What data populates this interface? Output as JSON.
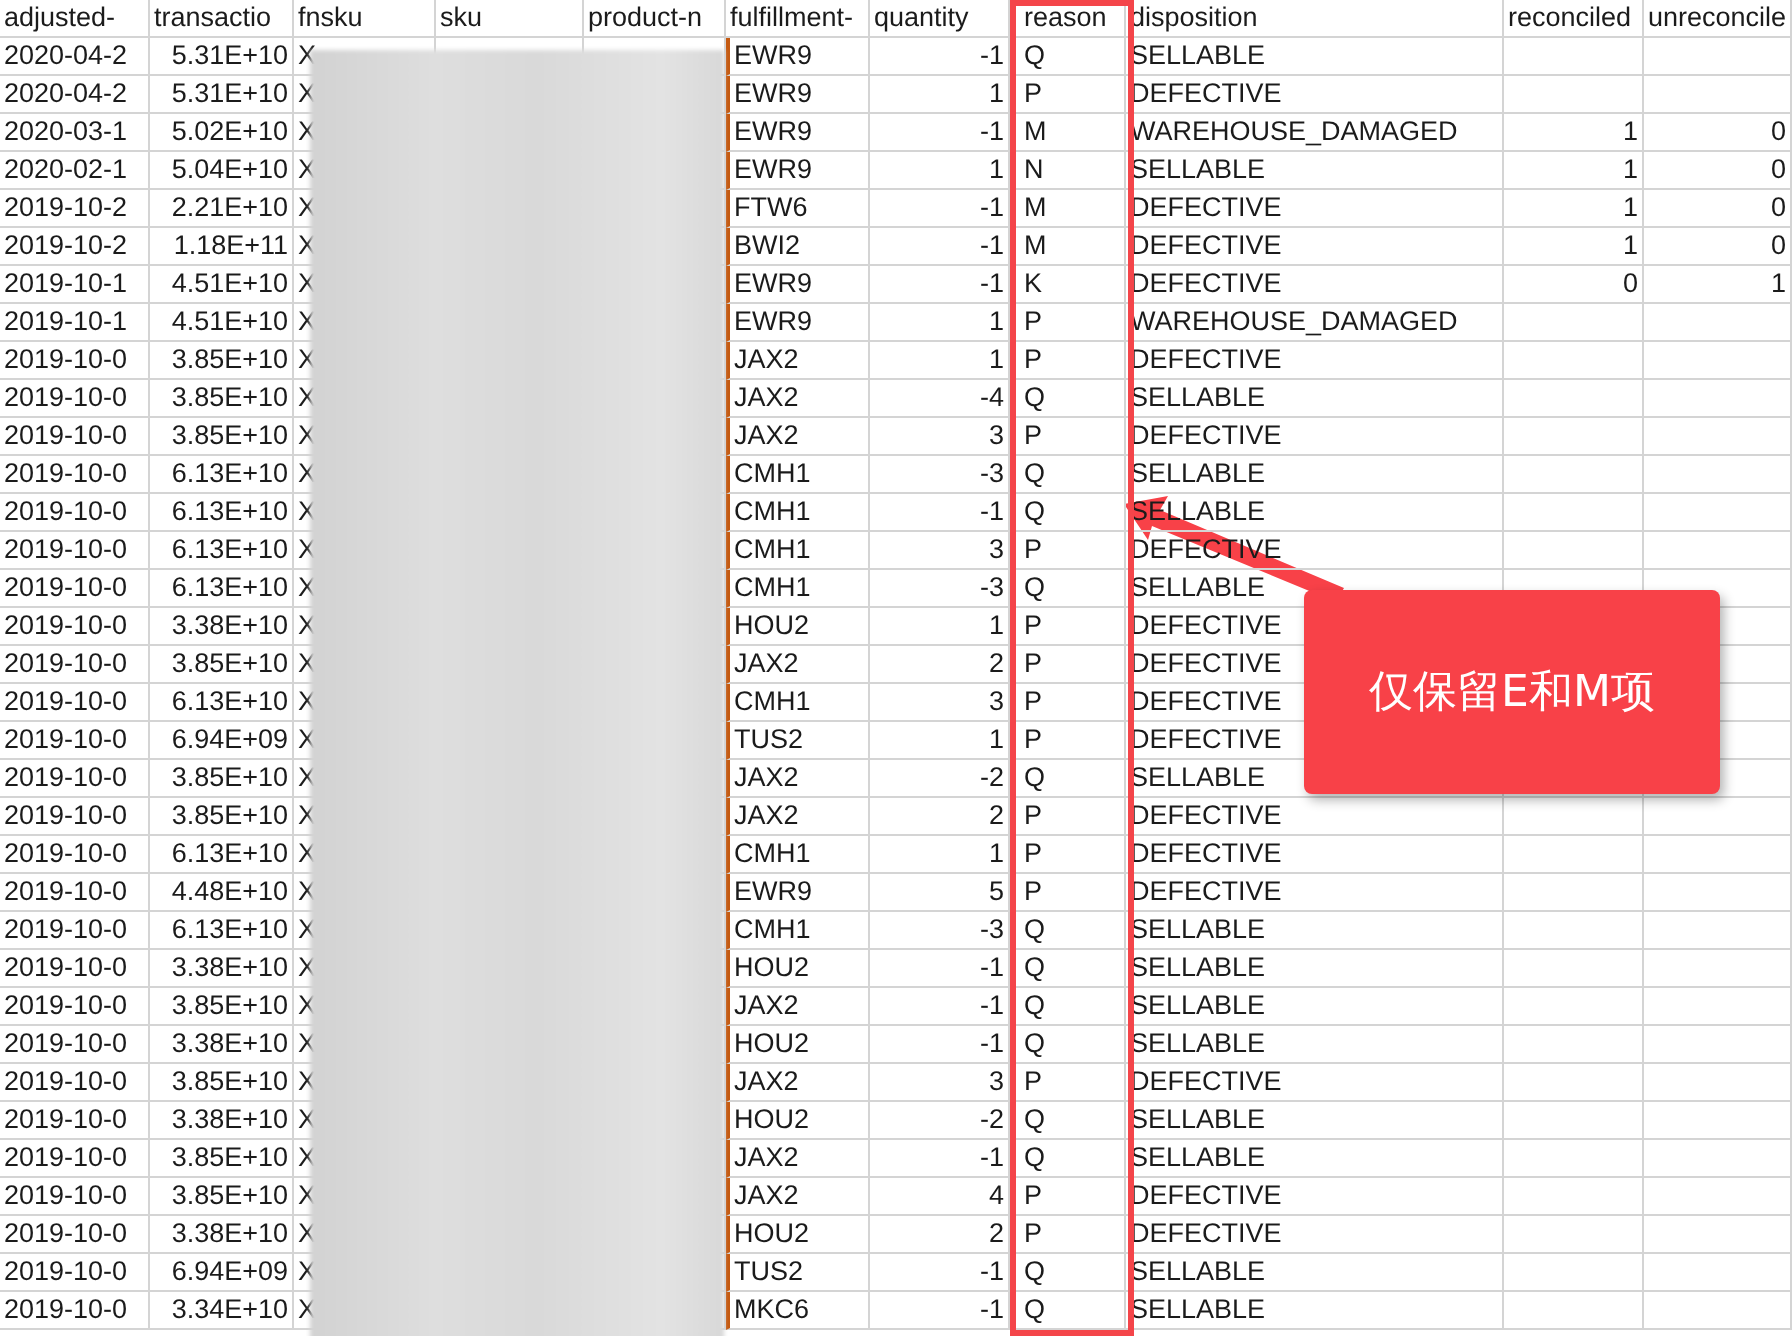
{
  "columns": [
    "adjusted-",
    "transactio",
    "fnsku",
    "sku",
    "product-n",
    "fulfillment-",
    "quantity",
    "reason",
    "disposition",
    "reconciled",
    "unreconcile"
  ],
  "rows": [
    {
      "date": "2020-04-2",
      "transaction": "5.31E+10",
      "fnsku": "X",
      "fc": "EWR9",
      "quantity": "-1",
      "reason": "Q",
      "disposition": "SELLABLE"
    },
    {
      "date": "2020-04-2",
      "transaction": "5.31E+10",
      "fnsku": "X",
      "fc": "EWR9",
      "quantity": "1",
      "reason": "P",
      "disposition": "DEFECTIVE"
    },
    {
      "date": "2020-03-1",
      "transaction": "5.02E+10",
      "fnsku": "X",
      "fc": "EWR9",
      "quantity": "-1",
      "reason": "M",
      "disposition": "WAREHOUSE_DAMAGED",
      "reconciled": "1",
      "unreconciled": "0"
    },
    {
      "date": "2020-02-1",
      "transaction": "5.04E+10",
      "fnsku": "X",
      "fc": "EWR9",
      "quantity": "1",
      "reason": "N",
      "disposition": "SELLABLE",
      "reconciled": "1",
      "unreconciled": "0"
    },
    {
      "date": "2019-10-2",
      "transaction": "2.21E+10",
      "fnsku": "X",
      "fc": "FTW6",
      "quantity": "-1",
      "reason": "M",
      "disposition": "DEFECTIVE",
      "reconciled": "1",
      "unreconciled": "0"
    },
    {
      "date": "2019-10-2",
      "transaction": "1.18E+11",
      "fnsku": "X",
      "fc": "BWI2",
      "quantity": "-1",
      "reason": "M",
      "disposition": "DEFECTIVE",
      "reconciled": "1",
      "unreconciled": "0"
    },
    {
      "date": "2019-10-1",
      "transaction": "4.51E+10",
      "fnsku": "X",
      "fc": "EWR9",
      "quantity": "-1",
      "reason": "K",
      "disposition": "DEFECTIVE",
      "reconciled": "0",
      "unreconciled": "1"
    },
    {
      "date": "2019-10-1",
      "transaction": "4.51E+10",
      "fnsku": "X",
      "fc": "EWR9",
      "quantity": "1",
      "reason": "P",
      "disposition": "WAREHOUSE_DAMAGED"
    },
    {
      "date": "2019-10-0",
      "transaction": "3.85E+10",
      "fnsku": "X",
      "fc": "JAX2",
      "quantity": "1",
      "reason": "P",
      "disposition": "DEFECTIVE"
    },
    {
      "date": "2019-10-0",
      "transaction": "3.85E+10",
      "fnsku": "X",
      "fc": "JAX2",
      "quantity": "-4",
      "reason": "Q",
      "disposition": "SELLABLE"
    },
    {
      "date": "2019-10-0",
      "transaction": "3.85E+10",
      "fnsku": "X",
      "fc": "JAX2",
      "quantity": "3",
      "reason": "P",
      "disposition": "DEFECTIVE"
    },
    {
      "date": "2019-10-0",
      "transaction": "6.13E+10",
      "fnsku": "X",
      "fc": "CMH1",
      "quantity": "-3",
      "reason": "Q",
      "disposition": "SELLABLE"
    },
    {
      "date": "2019-10-0",
      "transaction": "6.13E+10",
      "fnsku": "X",
      "fc": "CMH1",
      "quantity": "-1",
      "reason": "Q",
      "disposition": "SELLABLE"
    },
    {
      "date": "2019-10-0",
      "transaction": "6.13E+10",
      "fnsku": "X",
      "fc": "CMH1",
      "quantity": "3",
      "reason": "P",
      "disposition": "DEFECTIVE"
    },
    {
      "date": "2019-10-0",
      "transaction": "6.13E+10",
      "fnsku": "X",
      "fc": "CMH1",
      "quantity": "-3",
      "reason": "Q",
      "disposition": "SELLABLE"
    },
    {
      "date": "2019-10-0",
      "transaction": "3.38E+10",
      "fnsku": "X",
      "fc": "HOU2",
      "quantity": "1",
      "reason": "P",
      "disposition": "DEFECTIVE"
    },
    {
      "date": "2019-10-0",
      "transaction": "3.85E+10",
      "fnsku": "X",
      "fc": "JAX2",
      "quantity": "2",
      "reason": "P",
      "disposition": "DEFECTIVE"
    },
    {
      "date": "2019-10-0",
      "transaction": "6.13E+10",
      "fnsku": "X",
      "fc": "CMH1",
      "quantity": "3",
      "reason": "P",
      "disposition": "DEFECTIVE"
    },
    {
      "date": "2019-10-0",
      "transaction": "6.94E+09",
      "fnsku": "X",
      "fc": "TUS2",
      "quantity": "1",
      "reason": "P",
      "disposition": "DEFECTIVE"
    },
    {
      "date": "2019-10-0",
      "transaction": "3.85E+10",
      "fnsku": "X",
      "fc": "JAX2",
      "quantity": "-2",
      "reason": "Q",
      "disposition": "SELLABLE"
    },
    {
      "date": "2019-10-0",
      "transaction": "3.85E+10",
      "fnsku": "X",
      "fc": "JAX2",
      "quantity": "2",
      "reason": "P",
      "disposition": "DEFECTIVE"
    },
    {
      "date": "2019-10-0",
      "transaction": "6.13E+10",
      "fnsku": "X",
      "fc": "CMH1",
      "quantity": "1",
      "reason": "P",
      "disposition": "DEFECTIVE"
    },
    {
      "date": "2019-10-0",
      "transaction": "4.48E+10",
      "fnsku": "X",
      "fc": "EWR9",
      "quantity": "5",
      "reason": "P",
      "disposition": "DEFECTIVE"
    },
    {
      "date": "2019-10-0",
      "transaction": "6.13E+10",
      "fnsku": "X",
      "fc": "CMH1",
      "quantity": "-3",
      "reason": "Q",
      "disposition": "SELLABLE"
    },
    {
      "date": "2019-10-0",
      "transaction": "3.38E+10",
      "fnsku": "X",
      "fc": "HOU2",
      "quantity": "-1",
      "reason": "Q",
      "disposition": "SELLABLE"
    },
    {
      "date": "2019-10-0",
      "transaction": "3.85E+10",
      "fnsku": "X",
      "fc": "JAX2",
      "quantity": "-1",
      "reason": "Q",
      "disposition": "SELLABLE"
    },
    {
      "date": "2019-10-0",
      "transaction": "3.38E+10",
      "fnsku": "X",
      "fc": "HOU2",
      "quantity": "-1",
      "reason": "Q",
      "disposition": "SELLABLE"
    },
    {
      "date": "2019-10-0",
      "transaction": "3.85E+10",
      "fnsku": "X",
      "fc": "JAX2",
      "quantity": "3",
      "reason": "P",
      "disposition": "DEFECTIVE"
    },
    {
      "date": "2019-10-0",
      "transaction": "3.38E+10",
      "fnsku": "X",
      "fc": "HOU2",
      "quantity": "-2",
      "reason": "Q",
      "disposition": "SELLABLE"
    },
    {
      "date": "2019-10-0",
      "transaction": "3.85E+10",
      "fnsku": "X",
      "fc": "JAX2",
      "quantity": "-1",
      "reason": "Q",
      "disposition": "SELLABLE"
    },
    {
      "date": "2019-10-0",
      "transaction": "3.85E+10",
      "fnsku": "X",
      "fc": "JAX2",
      "quantity": "4",
      "reason": "P",
      "disposition": "DEFECTIVE"
    },
    {
      "date": "2019-10-0",
      "transaction": "3.38E+10",
      "fnsku": "X",
      "fc": "HOU2",
      "quantity": "2",
      "reason": "P",
      "disposition": "DEFECTIVE"
    },
    {
      "date": "2019-10-0",
      "transaction": "6.94E+09",
      "fnsku": "X",
      "fc": "TUS2",
      "quantity": "-1",
      "reason": "Q",
      "disposition": "SELLABLE"
    },
    {
      "date": "2019-10-0",
      "transaction": "3.34E+10",
      "fnsku": "X",
      "fc": "MKC6",
      "quantity": "-1",
      "reason": "Q",
      "disposition": "SELLABLE"
    }
  ],
  "callout": {
    "text": "仅保留E和M项"
  }
}
